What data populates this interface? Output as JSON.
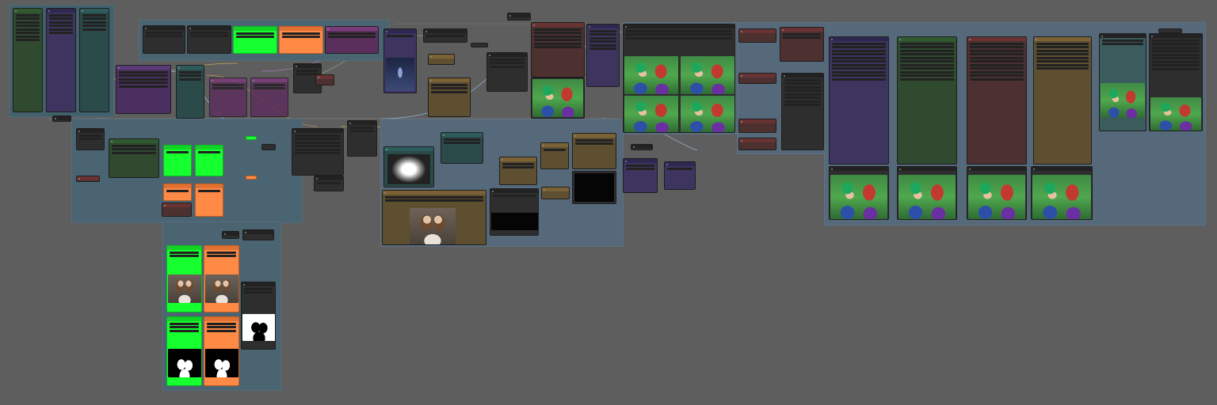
{
  "window": {
    "title": ""
  },
  "colors": {
    "canvas": "#5e5e5e",
    "group_blue": "#3a5a6b",
    "group_green": "#4a6a4a",
    "group_purple": "#55507a",
    "node_lime": "#16ff2e",
    "node_orange": "#ff8a45",
    "node_magenta": "#7a3d7a"
  },
  "icons": [
    "node-status-dot-icon"
  ],
  "images": {
    "anime_output": "anime-portrait-image",
    "photo_input": "photo-portrait-image",
    "mask": "segmentation-mask-image",
    "depth": "depth-map-image",
    "pose": "pose-skeleton-image",
    "scene": "scene-preview-image"
  }
}
